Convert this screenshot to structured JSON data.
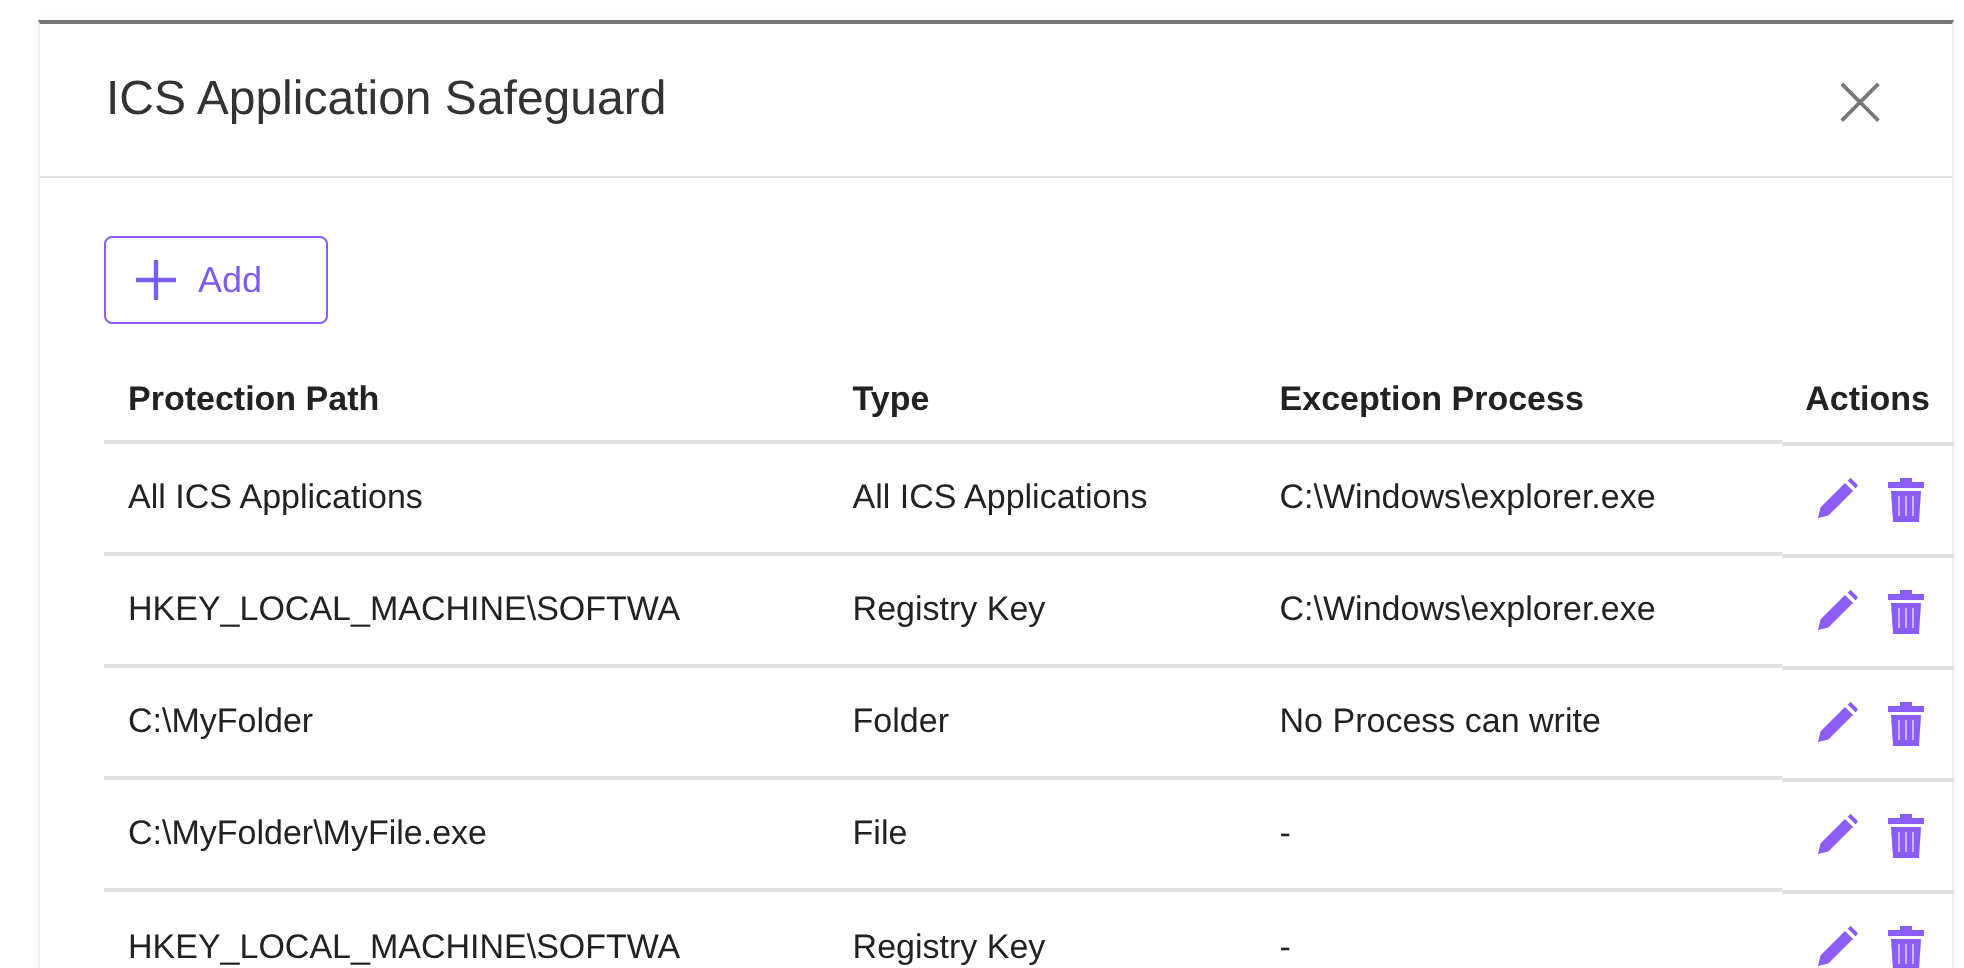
{
  "window": {
    "title": "ICS Application Safeguard",
    "close": "×"
  },
  "add_button": {
    "label": "Add"
  },
  "table": {
    "columns": [
      "Protection Path",
      "Type",
      "Exception Process",
      "Actions"
    ],
    "rows": [
      {
        "path": "All ICS Applications",
        "type": "All ICS Applications",
        "process": "C:\\Windows\\explorer.exe"
      },
      {
        "path": "HKEY_LOCAL_MACHINE\\SOFTWA",
        "type": "Registry Key",
        "process": "C:\\Windows\\explorer.exe"
      },
      {
        "path": "C:\\MyFolder",
        "type": "Folder",
        "process": "No Process can write"
      },
      {
        "path": "C:\\MyFolder\\MyFile.exe",
        "type": "File",
        "process": "-"
      },
      {
        "path": "HKEY_LOCAL_MACHINE\\SOFTWA",
        "type": "Registry Key",
        "process": "-"
      }
    ]
  }
}
